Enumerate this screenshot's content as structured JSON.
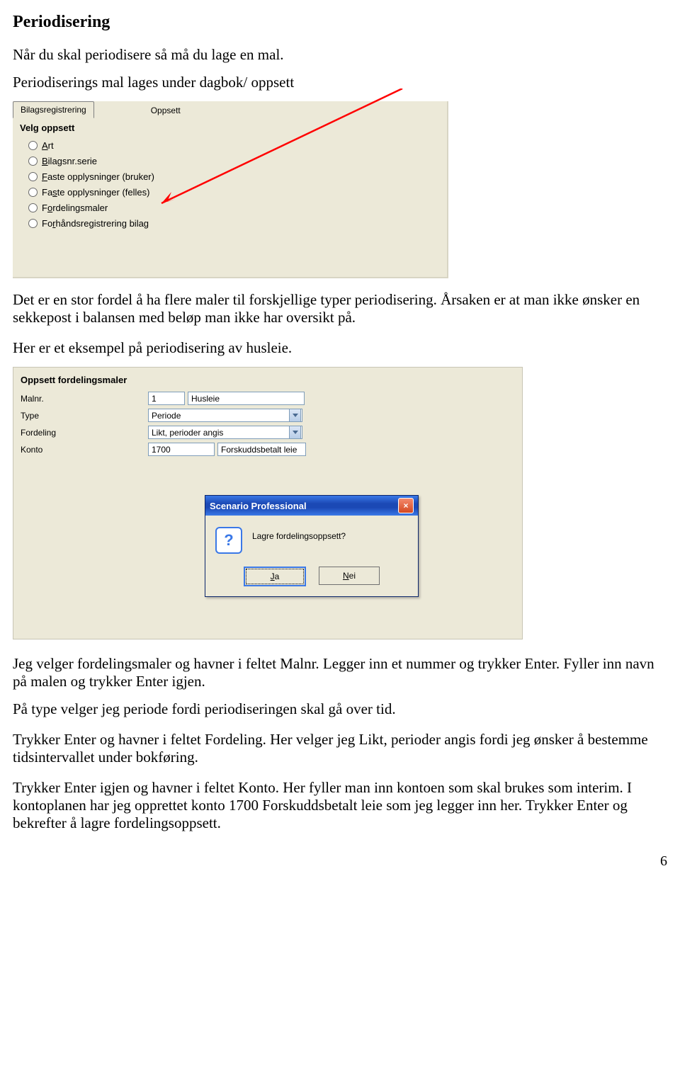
{
  "title": "Periodisering",
  "intro_line1": "Når du skal periodisere så må du lage en mal.",
  "intro_line2": "Periodiserings mal lages under dagbok/ oppsett",
  "panel1": {
    "tab_active": "Bilagsregistrering",
    "tab_other": "Oppsett",
    "fieldset": "Velg oppsett",
    "options": [
      {
        "html": "<span class='custom-u'>A</span>rt"
      },
      {
        "html": "<span class='custom-u'>B</span>ilagsnr.serie"
      },
      {
        "html": "<span class='custom-u'>F</span>aste opplysninger (bruker)"
      },
      {
        "html": "Fa<span class='custom-u'>s</span>te opplysninger (felles)"
      },
      {
        "html": "F<span class='custom-u'>o</span>rdelingsmaler"
      },
      {
        "html": "Fo<span class='custom-u'>r</span>håndsregistrering bilag"
      }
    ],
    "options_plain": [
      "Art",
      "Bilagsnr.serie",
      "Faste opplysninger (bruker)",
      "Faste opplysninger (felles)",
      "Fordelingsmaler",
      "Forhåndsregistrering bilag"
    ]
  },
  "mid_para1": "Det er en stor fordel å ha flere maler til forskjellige typer periodisering. Årsaken er at man ikke ønsker en sekkepost i balansen med beløp man ikke har oversikt på.",
  "mid_para2": "Her er et eksempel på periodisering av husleie.",
  "panel2": {
    "group_title": "Oppsett fordelingsmaler",
    "rows": {
      "malnr_label": "Malnr.",
      "malnr_value": "1",
      "malnr_name": "Husleie",
      "type_label": "Type",
      "type_value": "Periode",
      "fordeling_label": "Fordeling",
      "fordeling_value": "Likt, perioder angis",
      "konto_label": "Konto",
      "konto_value": "1700",
      "konto_name": "Forskuddsbetalt leie"
    },
    "dialog": {
      "title": "Scenario Professional",
      "message": "Lagre fordelingsoppsett?",
      "btn_yes": "Ja",
      "btn_no": "Nei"
    }
  },
  "body_paras": [
    "Jeg velger fordelingsmaler og havner i feltet Malnr. Legger inn et nummer og trykker Enter. Fyller inn navn på malen og trykker Enter igjen.",
    "På type velger jeg periode fordi periodiseringen skal gå over tid.",
    "Trykker Enter og havner i feltet Fordeling. Her velger jeg Likt, perioder angis fordi jeg ønsker å bestemme tidsintervallet under bokføring.",
    "Trykker Enter igjen og havner i feltet Konto. Her fyller man inn kontoen som skal brukes som interim. I kontoplanen har jeg opprettet konto 1700 Forskuddsbetalt leie som jeg legger inn her. Trykker Enter og bekrefter å lagre fordelingsoppsett."
  ],
  "page_number": "6"
}
